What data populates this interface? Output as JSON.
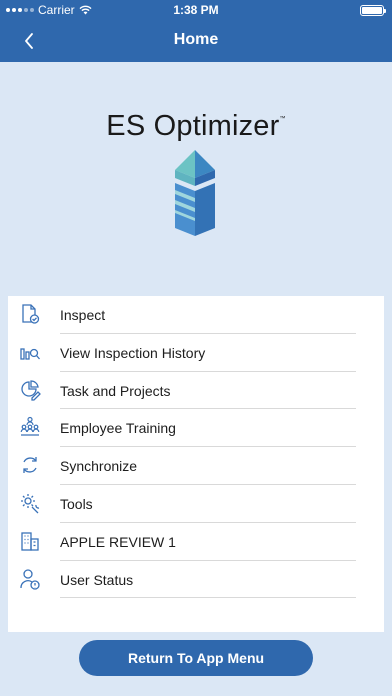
{
  "status_bar": {
    "carrier": "Carrier",
    "time": "1:38 PM"
  },
  "nav": {
    "title": "Home",
    "back_icon": "chevron-left-icon"
  },
  "logo": {
    "text": "ES Optimizer",
    "trademark": "™"
  },
  "menu": {
    "items": [
      {
        "label": "Inspect",
        "icon": "document-check-icon"
      },
      {
        "label": "View Inspection History",
        "icon": "chart-search-icon"
      },
      {
        "label": "Task and Projects",
        "icon": "pie-pencil-icon"
      },
      {
        "label": "Employee Training",
        "icon": "people-group-icon"
      },
      {
        "label": "Synchronize",
        "icon": "sync-icon"
      },
      {
        "label": "Tools",
        "icon": "gear-wrench-icon"
      },
      {
        "label": "APPLE REVIEW 1",
        "icon": "building-icon"
      },
      {
        "label": "User Status",
        "icon": "user-status-icon"
      }
    ]
  },
  "return_button": {
    "label": "Return To App Menu"
  },
  "colors": {
    "primary": "#2f68ad",
    "background": "#dbe7f5",
    "icon": "#3a72b8",
    "logo_teal": "#6cc3c4",
    "logo_blue": "#3372b5"
  }
}
